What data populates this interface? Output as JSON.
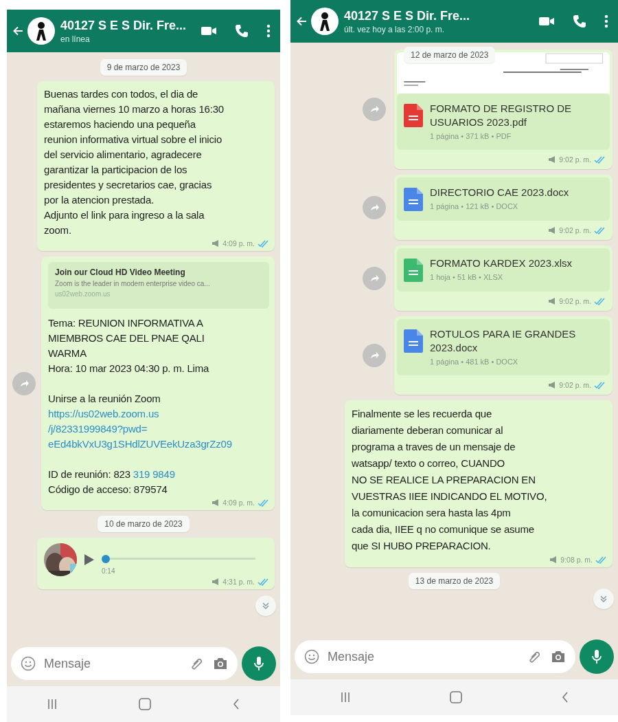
{
  "phones": [
    {
      "header": {
        "name": "40127 S E S Dir. Fre...",
        "status": "en línea"
      },
      "items": [
        {
          "kind": "date",
          "text": "9 de marzo de 2023"
        },
        {
          "kind": "text",
          "forward": false,
          "text": "Buenas tardes con todos, el dia de\nmañana viernes 10 marzo a horas 16:30\nestaremos haciendo una pequeña\nreunion informativa virtual sobre el inicio\ndel servicio alimentario, agradecere\ngarantizar la participacion de los\npresidentes y secretarios cae, gracias\npor la atencion prestada.\nAdjunto el link para ingreso a la sala\nzoom.",
          "time": "4:09 p. m.",
          "read": true
        },
        {
          "kind": "link",
          "forward": true,
          "preview": {
            "title": "Join our Cloud HD Video Meeting",
            "description": "Zoom is the leader in modern enterprise video ca...",
            "domain": "us02web.zoom.us"
          },
          "paragraphs": [
            {
              "lines": [
                {
                  "parts": [
                    {
                      "text": "Tema: REUNION INFORMATIVA A",
                      "link": false
                    }
                  ]
                },
                {
                  "parts": [
                    {
                      "text": "MIEMBROS CAE DEL PNAE QALI",
                      "link": false
                    }
                  ]
                },
                {
                  "parts": [
                    {
                      "text": "WARMA",
                      "link": false
                    }
                  ]
                },
                {
                  "parts": [
                    {
                      "text": "Hora: 10 mar 2023 04:30 p. m. Lima",
                      "link": false
                    }
                  ]
                }
              ]
            },
            {
              "lines": [
                {
                  "parts": [
                    {
                      "text": "Unirse a la reunión Zoom",
                      "link": false
                    }
                  ]
                },
                {
                  "parts": [
                    {
                      "text": "https://us02web.zoom.us",
                      "link": true
                    }
                  ]
                },
                {
                  "parts": [
                    {
                      "text": "/j/82331999849?pwd=",
                      "link": true
                    }
                  ]
                },
                {
                  "parts": [
                    {
                      "text": "eEd4bkVxU3g1SHdlZUVEekUza3grZz09",
                      "link": true
                    }
                  ]
                }
              ]
            },
            {
              "lines": [
                {
                  "parts": [
                    {
                      "text": "ID de reunión: 823",
                      "link": false
                    },
                    {
                      "text": "319 9849",
                      "link": true
                    }
                  ]
                },
                {
                  "parts": [
                    {
                      "text": "Código de acceso: 879574",
                      "link": false
                    }
                  ]
                }
              ]
            }
          ],
          "time": "4:09 p. m.",
          "read": true
        },
        {
          "kind": "date",
          "text": "10 de marzo de 2023"
        },
        {
          "kind": "audio",
          "forward": false,
          "level": 0,
          "duration": "0:14",
          "time": "4:31 p. m.",
          "read": true
        }
      ],
      "scroll_down_button": true,
      "composer": {
        "placeholder": "Mensaje"
      }
    },
    {
      "header": {
        "name": "40127 S E S Dir. Fre...",
        "status": "últ. vez hoy a las 2:00 p. m."
      },
      "floating_date": "12 de marzo de 2023",
      "items": [
        {
          "kind": "file",
          "forward": true,
          "thumbnail": true,
          "color": "#e53935",
          "name": "FORMATO DE REGISTRO DE USUARIOS 2023.pdf",
          "meta": "1 página • 371 kB • PDF",
          "time": "9:02 p. m.",
          "read": true
        },
        {
          "kind": "file",
          "forward": true,
          "thumbnail": false,
          "color": "#4a86e8",
          "name": "DIRECTORIO CAE 2023.docx",
          "meta": "1 página • 121 kB • DOCX",
          "time": "9:02 p. m.",
          "read": true
        },
        {
          "kind": "file",
          "forward": true,
          "thumbnail": false,
          "color": "#3dba6f",
          "name": "FORMATO KARDEX 2023.xlsx",
          "meta": "1 hoja • 51 kB • XLSX",
          "time": "9:02 p. m.",
          "read": true
        },
        {
          "kind": "file",
          "forward": true,
          "thumbnail": false,
          "color": "#4a86e8",
          "name": "ROTULOS PARA IE GRANDES 2023.docx",
          "meta": "1 página • 481 kB • DOCX",
          "time": "9:02 p. m.",
          "read": true
        },
        {
          "kind": "text",
          "forward": false,
          "text": "Finalmente se les recuerda que\ndiariamente deberan comunicar al\nprograma a traves de un mensaje de\nwatsapp/ texto o correo, CUANDO\nNO SE REALICE LA PREPARACION EN\nVUESTRAS IIEE INDICANDO EL MOTIVO,\nla comunicacion sera hasta las 4pm\ncada dia, IIEE q no comunique se asume\nque SI HUBO PREPARACION.",
          "time": "9:08 p. m.",
          "read": true
        },
        {
          "kind": "date",
          "text": "13 de marzo de 2023"
        }
      ],
      "scroll_down_button": true,
      "composer": {
        "placeholder": "Mensaje"
      }
    }
  ]
}
